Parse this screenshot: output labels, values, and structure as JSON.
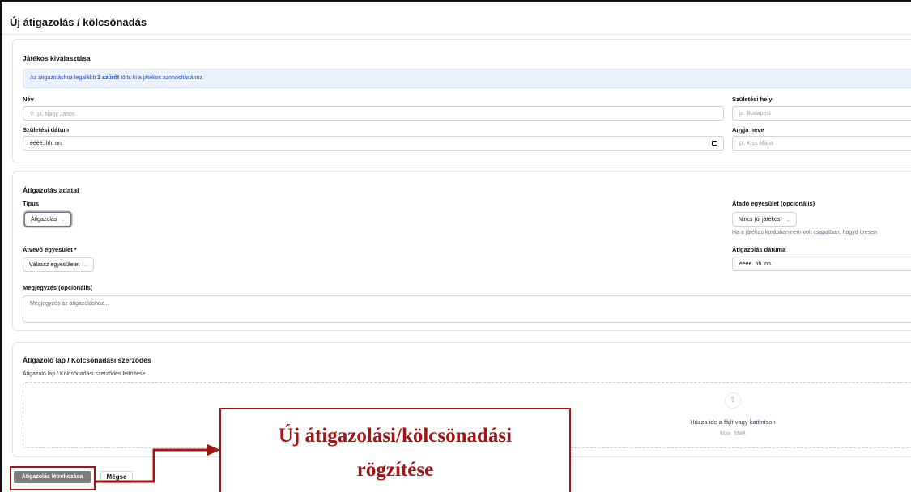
{
  "page": {
    "title": "Új átigazolás / kölcsönadás"
  },
  "player_section": {
    "title": "Játékos kiválasztása",
    "info_prefix": "Az átigazoláshoz legalább ",
    "info_bold": "2 szűrőt",
    "info_suffix": " tölts ki a játékos azonosításához.",
    "name": {
      "label": "Név",
      "placeholder": "pl. Nagy János"
    },
    "birth_place": {
      "label": "Születési hely",
      "placeholder": "pl. Budapest"
    },
    "birth_date": {
      "label": "Születési dátum",
      "value": "éééé. hh. nn."
    },
    "mother_name": {
      "label": "Anyja neve",
      "placeholder": "pl. Kiss Mária"
    }
  },
  "transfer_section": {
    "title": "Átigazolás adatai",
    "type": {
      "label": "Típus",
      "value": "Átigazolás"
    },
    "from_club": {
      "label": "Átadó egyesület (opcionális)",
      "value": "Nincs (új játékos)",
      "hint": "Ha a játékos korábban nem volt csapatban, hagyd üresen"
    },
    "to_club": {
      "label": "Átvevő egyesület *",
      "value": "Válassz egyesületet"
    },
    "transfer_date": {
      "label": "Átigazolás dátuma",
      "value": "éééé. hh. nn."
    },
    "note": {
      "label": "Megjegyzés (opcionális)",
      "placeholder": "Megjegyzés az átigazoláshoz..."
    }
  },
  "document_section": {
    "title": "Átigazoló lap / Kölcsönadási szerződés",
    "subtitle": "Átigazoló lap / Kölcsönadási szerződés feltöltése",
    "drop_text": "Húzza ide a fájlt vagy kattintson",
    "max_text": "Max. 5MB",
    "upload_icon": "upload-icon"
  },
  "actions": {
    "create_label": "Átigazolás létrehozása",
    "cancel_label": "Mégse"
  },
  "annotation": {
    "line1": "Új átigazolási/kölcsönadási",
    "line2": "rögzítése",
    "color": "#a31515"
  }
}
